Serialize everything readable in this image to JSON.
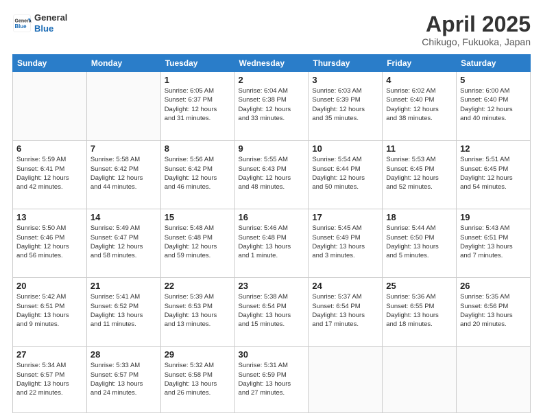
{
  "header": {
    "logo_line1": "General",
    "logo_line2": "Blue",
    "month": "April 2025",
    "location": "Chikugo, Fukuoka, Japan"
  },
  "days_of_week": [
    "Sunday",
    "Monday",
    "Tuesday",
    "Wednesday",
    "Thursday",
    "Friday",
    "Saturday"
  ],
  "weeks": [
    [
      {
        "day": "",
        "info": ""
      },
      {
        "day": "",
        "info": ""
      },
      {
        "day": "1",
        "info": "Sunrise: 6:05 AM\nSunset: 6:37 PM\nDaylight: 12 hours\nand 31 minutes."
      },
      {
        "day": "2",
        "info": "Sunrise: 6:04 AM\nSunset: 6:38 PM\nDaylight: 12 hours\nand 33 minutes."
      },
      {
        "day": "3",
        "info": "Sunrise: 6:03 AM\nSunset: 6:39 PM\nDaylight: 12 hours\nand 35 minutes."
      },
      {
        "day": "4",
        "info": "Sunrise: 6:02 AM\nSunset: 6:40 PM\nDaylight: 12 hours\nand 38 minutes."
      },
      {
        "day": "5",
        "info": "Sunrise: 6:00 AM\nSunset: 6:40 PM\nDaylight: 12 hours\nand 40 minutes."
      }
    ],
    [
      {
        "day": "6",
        "info": "Sunrise: 5:59 AM\nSunset: 6:41 PM\nDaylight: 12 hours\nand 42 minutes."
      },
      {
        "day": "7",
        "info": "Sunrise: 5:58 AM\nSunset: 6:42 PM\nDaylight: 12 hours\nand 44 minutes."
      },
      {
        "day": "8",
        "info": "Sunrise: 5:56 AM\nSunset: 6:42 PM\nDaylight: 12 hours\nand 46 minutes."
      },
      {
        "day": "9",
        "info": "Sunrise: 5:55 AM\nSunset: 6:43 PM\nDaylight: 12 hours\nand 48 minutes."
      },
      {
        "day": "10",
        "info": "Sunrise: 5:54 AM\nSunset: 6:44 PM\nDaylight: 12 hours\nand 50 minutes."
      },
      {
        "day": "11",
        "info": "Sunrise: 5:53 AM\nSunset: 6:45 PM\nDaylight: 12 hours\nand 52 minutes."
      },
      {
        "day": "12",
        "info": "Sunrise: 5:51 AM\nSunset: 6:45 PM\nDaylight: 12 hours\nand 54 minutes."
      }
    ],
    [
      {
        "day": "13",
        "info": "Sunrise: 5:50 AM\nSunset: 6:46 PM\nDaylight: 12 hours\nand 56 minutes."
      },
      {
        "day": "14",
        "info": "Sunrise: 5:49 AM\nSunset: 6:47 PM\nDaylight: 12 hours\nand 58 minutes."
      },
      {
        "day": "15",
        "info": "Sunrise: 5:48 AM\nSunset: 6:48 PM\nDaylight: 12 hours\nand 59 minutes."
      },
      {
        "day": "16",
        "info": "Sunrise: 5:46 AM\nSunset: 6:48 PM\nDaylight: 13 hours\nand 1 minute."
      },
      {
        "day": "17",
        "info": "Sunrise: 5:45 AM\nSunset: 6:49 PM\nDaylight: 13 hours\nand 3 minutes."
      },
      {
        "day": "18",
        "info": "Sunrise: 5:44 AM\nSunset: 6:50 PM\nDaylight: 13 hours\nand 5 minutes."
      },
      {
        "day": "19",
        "info": "Sunrise: 5:43 AM\nSunset: 6:51 PM\nDaylight: 13 hours\nand 7 minutes."
      }
    ],
    [
      {
        "day": "20",
        "info": "Sunrise: 5:42 AM\nSunset: 6:51 PM\nDaylight: 13 hours\nand 9 minutes."
      },
      {
        "day": "21",
        "info": "Sunrise: 5:41 AM\nSunset: 6:52 PM\nDaylight: 13 hours\nand 11 minutes."
      },
      {
        "day": "22",
        "info": "Sunrise: 5:39 AM\nSunset: 6:53 PM\nDaylight: 13 hours\nand 13 minutes."
      },
      {
        "day": "23",
        "info": "Sunrise: 5:38 AM\nSunset: 6:54 PM\nDaylight: 13 hours\nand 15 minutes."
      },
      {
        "day": "24",
        "info": "Sunrise: 5:37 AM\nSunset: 6:54 PM\nDaylight: 13 hours\nand 17 minutes."
      },
      {
        "day": "25",
        "info": "Sunrise: 5:36 AM\nSunset: 6:55 PM\nDaylight: 13 hours\nand 18 minutes."
      },
      {
        "day": "26",
        "info": "Sunrise: 5:35 AM\nSunset: 6:56 PM\nDaylight: 13 hours\nand 20 minutes."
      }
    ],
    [
      {
        "day": "27",
        "info": "Sunrise: 5:34 AM\nSunset: 6:57 PM\nDaylight: 13 hours\nand 22 minutes."
      },
      {
        "day": "28",
        "info": "Sunrise: 5:33 AM\nSunset: 6:57 PM\nDaylight: 13 hours\nand 24 minutes."
      },
      {
        "day": "29",
        "info": "Sunrise: 5:32 AM\nSunset: 6:58 PM\nDaylight: 13 hours\nand 26 minutes."
      },
      {
        "day": "30",
        "info": "Sunrise: 5:31 AM\nSunset: 6:59 PM\nDaylight: 13 hours\nand 27 minutes."
      },
      {
        "day": "",
        "info": ""
      },
      {
        "day": "",
        "info": ""
      },
      {
        "day": "",
        "info": ""
      }
    ]
  ]
}
